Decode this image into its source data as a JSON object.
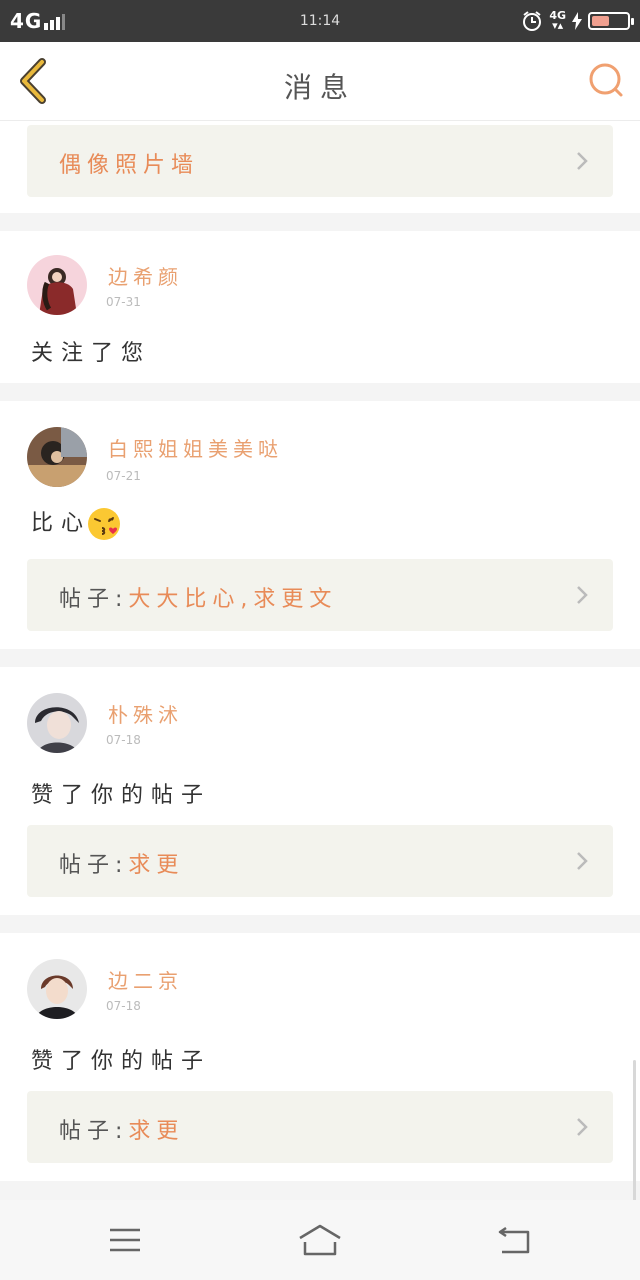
{
  "status_bar": {
    "network": "4G",
    "time": "11:14",
    "network_small": "4G"
  },
  "header": {
    "title": "消息"
  },
  "top_link": {
    "label": "偶像照片墙"
  },
  "notifications": [
    {
      "username": "边希颜",
      "date": "07-31",
      "message": "关注了您"
    },
    {
      "username": "白熙姐姐美美哒",
      "date": "07-21",
      "message": "比心",
      "emoji": "kiss-emoji",
      "post_prefix": "帖子:",
      "post_title": "大大比心,求更文"
    },
    {
      "username": "朴殊沭",
      "date": "07-18",
      "message": "赞了你的帖子",
      "post_prefix": "帖子:",
      "post_title": "求更"
    },
    {
      "username": "边二京",
      "date": "07-18",
      "message": "赞了你的帖子",
      "post_prefix": "帖子:",
      "post_title": "求更"
    }
  ],
  "colors": {
    "accent": "#e88b58",
    "back_arrow": "#e9b93c",
    "search": "#f0a070"
  }
}
